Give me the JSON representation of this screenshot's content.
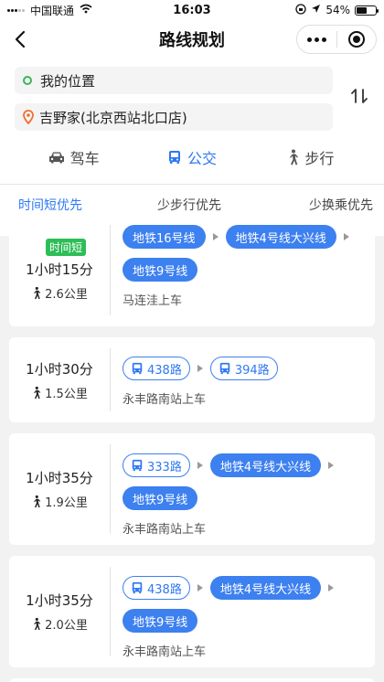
{
  "status": {
    "carrier": "中国联通",
    "time": "16:03",
    "battery": "54%",
    "battery_level": 0.54
  },
  "nav": {
    "title": "路线规划"
  },
  "search": {
    "origin": "我的位置",
    "destination": "吉野家(北京西站北口店)"
  },
  "modes": [
    {
      "label": "驾车",
      "icon": "car-icon"
    },
    {
      "label": "公交",
      "icon": "bus-icon"
    },
    {
      "label": "步行",
      "icon": "walk-icon"
    }
  ],
  "prefs": [
    "时间短优先",
    "少步行优先",
    "少换乘优先"
  ],
  "routes": [
    {
      "tag": "时间短",
      "duration": "1小时15分",
      "walk": "2.6公里",
      "station": "马连洼上车",
      "lines": [
        {
          "type": "subway",
          "name": "地铁16号线"
        },
        {
          "type": "subway",
          "name": "地铁4号线大兴线"
        },
        {
          "type": "subway",
          "name": "地铁9号线"
        }
      ]
    },
    {
      "tag": "",
      "duration": "1小时30分",
      "walk": "1.5公里",
      "station": "永丰路南站上车",
      "lines": [
        {
          "type": "bus",
          "name": "438路"
        },
        {
          "type": "bus",
          "name": "394路"
        }
      ]
    },
    {
      "tag": "",
      "duration": "1小时35分",
      "walk": "1.9公里",
      "station": "永丰路南站上车",
      "lines": [
        {
          "type": "bus",
          "name": "333路"
        },
        {
          "type": "subway",
          "name": "地铁4号线大兴线"
        },
        {
          "type": "subway",
          "name": "地铁9号线"
        }
      ]
    },
    {
      "tag": "",
      "duration": "1小时35分",
      "walk": "2.0公里",
      "station": "永丰路南站上车",
      "lines": [
        {
          "type": "bus",
          "name": "438路"
        },
        {
          "type": "subway",
          "name": "地铁4号线大兴线"
        },
        {
          "type": "subway",
          "name": "地铁9号线"
        }
      ]
    }
  ],
  "colors": {
    "accent": "#2f79f2",
    "subway_chip": "#3d80f0",
    "tag_green": "#2dbe57"
  }
}
